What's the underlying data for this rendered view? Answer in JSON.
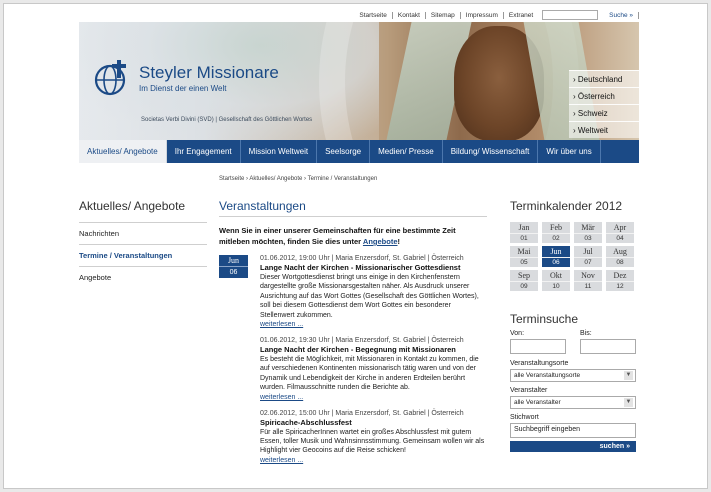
{
  "topnav": {
    "links": [
      "Startseite",
      "Kontakt",
      "Sitemap",
      "Impressum",
      "Extranet"
    ],
    "search_placeholder": "",
    "search_button": "Suche »"
  },
  "header": {
    "brand": "Steyler Missionare",
    "tagline": "Im Dienst der einen Welt",
    "subline": "Societas Verbi Divini (SVD) | Gesellschaft des Göttlichen Wortes",
    "countries": [
      "› Deutschland",
      "› Österreich",
      "› Schweiz",
      "› Weltweit"
    ]
  },
  "mainnav": [
    "Aktuelles/ Angebote",
    "Ihr Engagement",
    "Mission Weltweit",
    "Seelsorge",
    "Medien/ Presse",
    "Bildung/ Wissenschaft",
    "Wir über uns"
  ],
  "breadcrumb": "Startseite › Aktuelles/ Angebote › Termine / Veranstaltungen",
  "sidebar": {
    "title": "Aktuelles/ Angebote",
    "items": [
      "Nachrichten",
      "Termine / Veranstaltungen",
      "Angebote"
    ]
  },
  "main": {
    "title": "Veranstaltungen",
    "intro_text": "Wenn Sie in einer unserer Gemeinschaften für eine bestimmte Zeit mitleben möchten, finden Sie dies unter ",
    "intro_link": "Angebote",
    "intro_end": "!",
    "date_box": {
      "month": "Jun",
      "day": "06"
    },
    "events": [
      {
        "meta": "01.06.2012, 19:00 Uhr | Maria Enzersdorf, St. Gabriel | Österreich",
        "title": "Lange Nacht der Kirchen - Missionarischer Gottesdienst",
        "body": "Dieser Wortgottesdienst bringt uns einige in den Kirchenfenstern dargestellte große Missionarsgestalten näher. Als Ausdruck unserer Ausrichtung auf das Wort Gottes (Gesellschaft des Göttlichen Wortes), soll bei diesem Gottesdienst dem Wort Gottes ein besonderer Stellenwert zukommen.",
        "more": "weiterlesen ..."
      },
      {
        "meta": "01.06.2012, 19:30 Uhr | Maria Enzersdorf, St. Gabriel | Österreich",
        "title": "Lange Nacht der Kirchen - Begegnung mit Missionaren",
        "body": "Es besteht die Möglichkeit, mit Missionaren in Kontakt zu kommen, die auf verschiedenen Kontinenten missionarisch tätig waren und von der Dynamik und Lebendigkeit der Kirche in anderen Erdteilen berührt wurden. Filmausschnitte runden die Berichte ab.",
        "more": "weiterlesen ..."
      },
      {
        "meta": "02.06.2012, 15:00 Uhr | Maria Enzersdorf, St. Gabriel | Österreich",
        "title": "Spiricache-Abschlussfest",
        "body": "Für alle SpiricacherInnen wartet ein großes Abschlussfest mit gutem Essen, toller Musik und Wahnsinnsstimmung. Gemeinsam wollen wir als Highlight vier Geocoins auf die Reise schicken!",
        "more": "weiterlesen ..."
      }
    ]
  },
  "calendar": {
    "title": "Terminkalender 2012",
    "months": [
      {
        "m": "Jan",
        "n": "01"
      },
      {
        "m": "Feb",
        "n": "02"
      },
      {
        "m": "Mär",
        "n": "03"
      },
      {
        "m": "Apr",
        "n": "04"
      },
      {
        "m": "Mai",
        "n": "05"
      },
      {
        "m": "Jun",
        "n": "06"
      },
      {
        "m": "Jul",
        "n": "07"
      },
      {
        "m": "Aug",
        "n": "08"
      },
      {
        "m": "Sep",
        "n": "09"
      },
      {
        "m": "Okt",
        "n": "10"
      },
      {
        "m": "Nov",
        "n": "11"
      },
      {
        "m": "Dez",
        "n": "12"
      }
    ],
    "current": "Jun"
  },
  "search": {
    "title": "Terminsuche",
    "from_label": "Von:",
    "to_label": "Bis:",
    "location_label": "Veranstaltungsorte",
    "location_value": "alle Veranstaltungsorte",
    "organizer_label": "Veranstalter",
    "organizer_value": "alle Veranstalter",
    "keyword_label": "Stichwort",
    "keyword_value": "Suchbegriff eingeben",
    "button": "suchen »"
  },
  "colors": {
    "brand": "#1b4a86",
    "nav_active": "#eef0f3",
    "calendar_cell": "#d9dbde"
  }
}
